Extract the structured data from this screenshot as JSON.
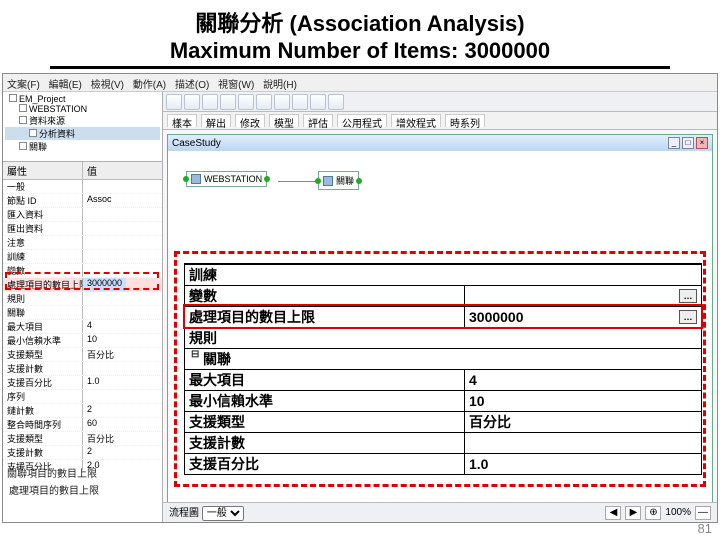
{
  "slide": {
    "title": "關聯分析 (Association Analysis)",
    "subtitle": "Maximum Number of Items: 3000000",
    "page_number": "81"
  },
  "menubar": [
    "文案(F)",
    "編輯(E)",
    "檢視(V)",
    "動作(A)",
    "描述(O)",
    "視窗(W)",
    "說明(H)"
  ],
  "tree": {
    "root": "EM_Project",
    "items": [
      "WEBSTATION",
      "資料來源",
      "分析資料",
      "關聯"
    ]
  },
  "prop_header": {
    "col_a": "屬性",
    "col_b": "值"
  },
  "left_props": [
    {
      "k": "一般",
      "v": ""
    },
    {
      "k": "節點 ID",
      "v": "Assoc"
    },
    {
      "k": "匯入資料",
      "v": ""
    },
    {
      "k": "匯出資料",
      "v": ""
    },
    {
      "k": "注意",
      "v": ""
    },
    {
      "k": "訓練",
      "v": ""
    },
    {
      "k": "變數",
      "v": ""
    },
    {
      "k": "處理項目的數目上限",
      "v": "3000000",
      "hl_left": true
    },
    {
      "k": "規則",
      "v": ""
    },
    {
      "k": "關聯",
      "v": ""
    },
    {
      "k": "最大項目",
      "v": "4"
    },
    {
      "k": "最小信賴水準",
      "v": "10"
    },
    {
      "k": "支援類型",
      "v": "百分比"
    },
    {
      "k": "支援計數",
      "v": ""
    },
    {
      "k": "支援百分比",
      "v": "1.0"
    },
    {
      "k": "序列",
      "v": ""
    },
    {
      "k": "鏈計數",
      "v": "2"
    },
    {
      "k": "整合時間序列",
      "v": "60"
    },
    {
      "k": "支援類型",
      "v": "百分比"
    },
    {
      "k": "支援計數",
      "v": "2"
    },
    {
      "k": "支援百分比",
      "v": "2.0"
    }
  ],
  "left_footer_1": "關聯項目的數目上限",
  "left_footer_2": "處理項目的數目上限",
  "tabs": [
    "樣本",
    "解出",
    "修改",
    "模型",
    "評估",
    "公用程式",
    "增效程式",
    "時系列"
  ],
  "doc": {
    "title": "CaseStudy"
  },
  "nodes": {
    "a": "WEBSTATION",
    "b": "關聯"
  },
  "main_table": {
    "sec_train": "訓練",
    "row_vars": {
      "k": "變數",
      "v": "",
      "has_btn": true
    },
    "row_max_items": {
      "k": "處理項目的數目上限",
      "v": "3000000",
      "has_btn": true,
      "highlight": true
    },
    "sec_rules": "規則",
    "sec_assoc": "關聯",
    "rows": [
      {
        "k": "最大項目",
        "v": "4"
      },
      {
        "k": "最小信賴水準",
        "v": "10"
      },
      {
        "k": "支援類型",
        "v": "百分比"
      },
      {
        "k": "支援計數",
        "v": ""
      },
      {
        "k": "支援百分比",
        "v": "1.0"
      }
    ],
    "tree_collapse": "⊟"
  },
  "statusbar": {
    "left_label": "流程圖",
    "dropdown": "一般",
    "zoom": "100%"
  },
  "icons": {
    "ellipsis": "…",
    "min": "_",
    "max": "□",
    "close": "×",
    "nav_l": "◀",
    "nav_r": "▶"
  }
}
